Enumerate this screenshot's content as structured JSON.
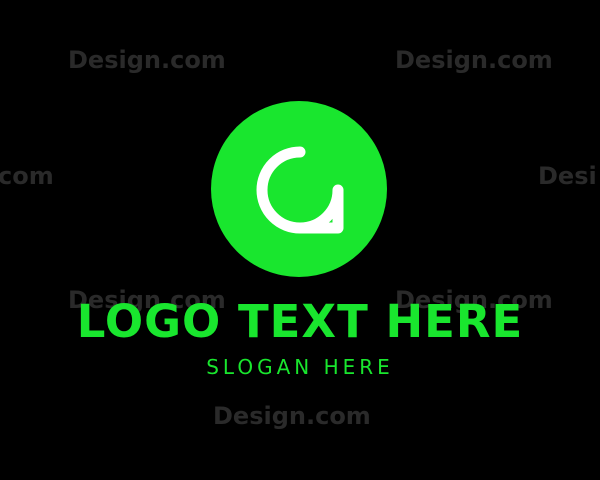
{
  "watermark": {
    "text": "Design.com",
    "partial_right": "Desi",
    "partial_left": "com",
    "color": "#2a2a2a"
  },
  "logo": {
    "icon": "speech-bubble-letter-a-icon",
    "circle_color": "#19e62e",
    "glyph_color": "#ffffff",
    "text": "LOGO TEXT HERE",
    "slogan": "SLOGAN HERE",
    "text_color": "#19e62e"
  },
  "background_color": "#000000"
}
